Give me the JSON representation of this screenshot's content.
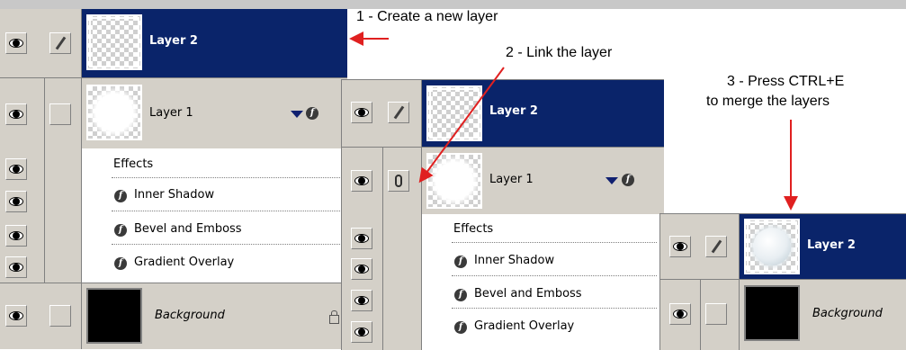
{
  "annotations": {
    "step1": "1 - Create a new layer",
    "step2": "2 - Link the layer",
    "step3_line1": "3 - Press CTRL+E",
    "step3_line2": "to merge the layers"
  },
  "panel1": {
    "layer2": "Layer 2",
    "layer1": "Layer 1",
    "effects_label": "Effects",
    "effects": [
      "Inner Shadow",
      "Bevel and Emboss",
      "Gradient Overlay"
    ],
    "background": "Background"
  },
  "panel2": {
    "layer2": "Layer 2",
    "layer1": "Layer 1",
    "effects_label": "Effects",
    "effects": [
      "Inner Shadow",
      "Bevel and Emboss",
      "Gradient Overlay"
    ]
  },
  "panel3": {
    "layer2": "Layer 2",
    "background": "Background"
  },
  "icons": {
    "visibility": "eye-icon",
    "brush": "brush-icon",
    "link": "link-chain-icon",
    "effects": "fx-icon",
    "expand": "triangle-down-icon",
    "lock": "lock-icon"
  },
  "colors": {
    "selection": "#0a246a",
    "panel_gray": "#d4d0c8",
    "arrow": "#e02020"
  }
}
